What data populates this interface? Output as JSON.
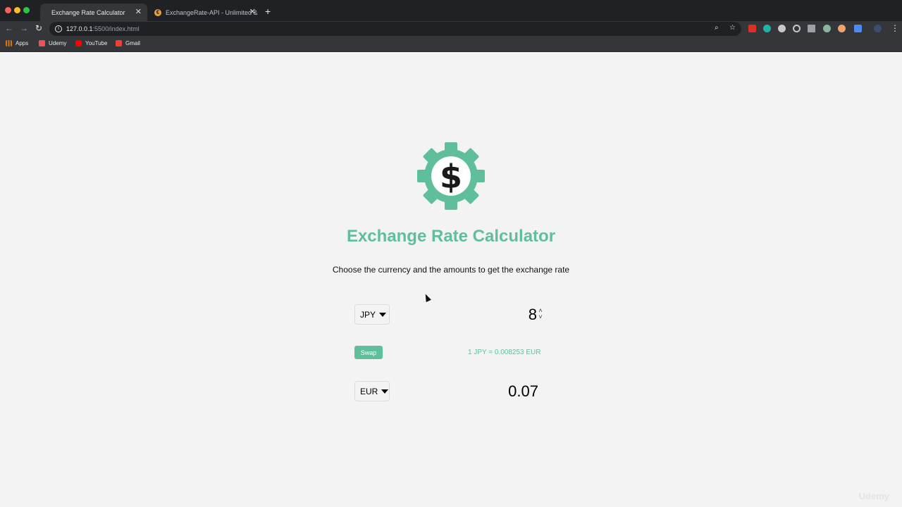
{
  "browser": {
    "tabs": [
      {
        "title": "Exchange Rate Calculator",
        "active": true
      },
      {
        "title": "ExchangeRate-API - Unlimited &",
        "active": false,
        "favicon": "€"
      }
    ],
    "url": {
      "host": "127.0.0.1",
      "rest": ":5500/index.html"
    },
    "bookmarks": [
      {
        "label": "Apps",
        "icon": "apps-grid-icon"
      },
      {
        "label": "Udemy",
        "icon": "udemy-icon"
      },
      {
        "label": "YouTube",
        "icon": "youtube-icon"
      },
      {
        "label": "Gmail",
        "icon": "gmail-icon"
      }
    ]
  },
  "page": {
    "title": "Exchange Rate Calculator",
    "subtitle": "Choose the currency and the amounts to get the exchange rate",
    "currency_one": {
      "value": "JPY"
    },
    "amount_one": {
      "value": "8"
    },
    "swap_label": "Swap",
    "rate_text": "1 JPY = 0.008253 EUR",
    "currency_two": {
      "value": "EUR"
    },
    "amount_two": {
      "value": "0.07"
    },
    "logo_icon": "dollar-gear-icon"
  },
  "colors": {
    "accent": "#5fbf9b",
    "background": "#f3f3f3",
    "chrome_dark": "#202124",
    "chrome_mid": "#35363a"
  },
  "watermark": "Udemy"
}
